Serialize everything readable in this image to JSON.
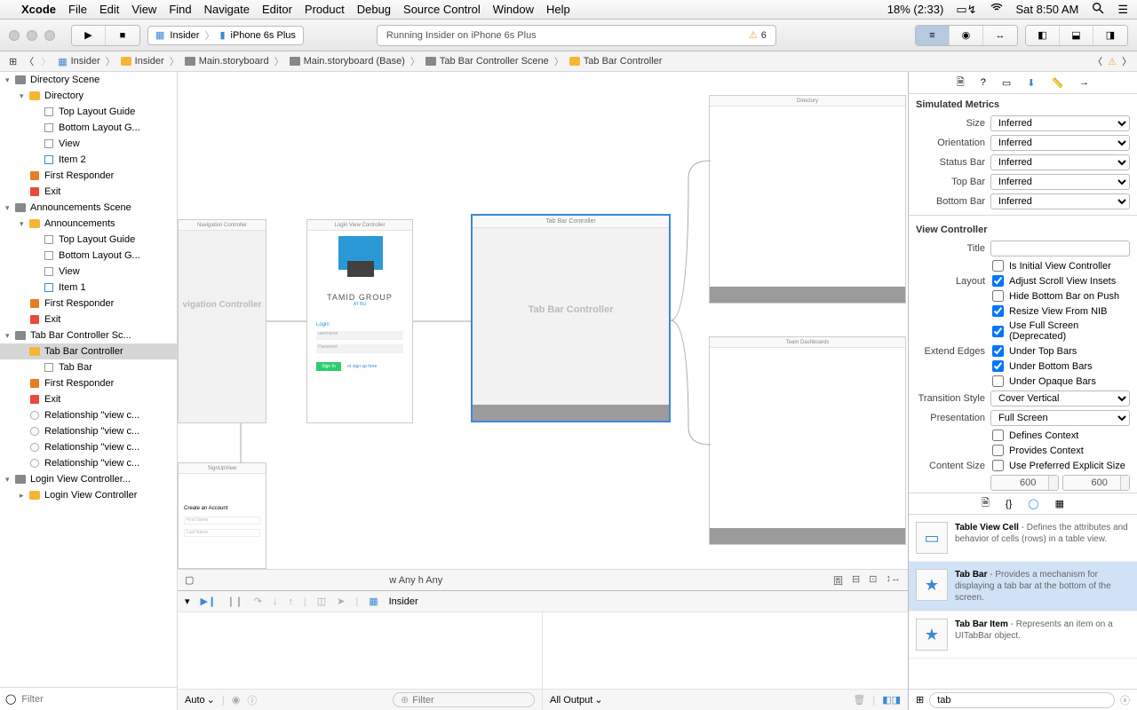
{
  "menubar": {
    "appname": "Xcode",
    "items": [
      "File",
      "Edit",
      "View",
      "Find",
      "Navigate",
      "Editor",
      "Product",
      "Debug",
      "Source Control",
      "Window",
      "Help"
    ],
    "battery": "18% (2:33)",
    "clock": "Sat 8:50 AM"
  },
  "toolbar": {
    "scheme_target": "Insider",
    "scheme_device": "iPhone 6s Plus",
    "activity_text": "Running Insider on iPhone 6s Plus",
    "warning_count": "6"
  },
  "jumpbar": {
    "segments": [
      "Insider",
      "Insider",
      "Main.storyboard",
      "Main.storyboard (Base)",
      "Tab Bar Controller Scene",
      "Tab Bar Controller"
    ]
  },
  "navigator": {
    "filter_placeholder": "Filter",
    "tree": [
      {
        "depth": 0,
        "disc": "▾",
        "ico": "scene",
        "label": "Directory Scene"
      },
      {
        "depth": 1,
        "disc": "▾",
        "ico": "folder",
        "label": "Directory"
      },
      {
        "depth": 2,
        "disc": "",
        "ico": "view",
        "label": "Top Layout Guide"
      },
      {
        "depth": 2,
        "disc": "",
        "ico": "view",
        "label": "Bottom Layout G..."
      },
      {
        "depth": 2,
        "disc": "",
        "ico": "view",
        "label": "View"
      },
      {
        "depth": 2,
        "disc": "",
        "ico": "item",
        "label": "Item 2"
      },
      {
        "depth": 1,
        "disc": "",
        "ico": "cube",
        "label": "First Responder"
      },
      {
        "depth": 1,
        "disc": "",
        "ico": "exit",
        "label": "Exit"
      },
      {
        "depth": 0,
        "disc": "▾",
        "ico": "scene",
        "label": "Announcements Scene"
      },
      {
        "depth": 1,
        "disc": "▾",
        "ico": "folder",
        "label": "Announcements"
      },
      {
        "depth": 2,
        "disc": "",
        "ico": "view",
        "label": "Top Layout Guide"
      },
      {
        "depth": 2,
        "disc": "",
        "ico": "view",
        "label": "Bottom Layout G..."
      },
      {
        "depth": 2,
        "disc": "",
        "ico": "view",
        "label": "View"
      },
      {
        "depth": 2,
        "disc": "",
        "ico": "item",
        "label": "Item 1"
      },
      {
        "depth": 1,
        "disc": "",
        "ico": "cube",
        "label": "First Responder"
      },
      {
        "depth": 1,
        "disc": "",
        "ico": "exit",
        "label": "Exit"
      },
      {
        "depth": 0,
        "disc": "▾",
        "ico": "scene",
        "label": "Tab Bar Controller Sc..."
      },
      {
        "depth": 1,
        "disc": "",
        "ico": "folder",
        "label": "Tab Bar Controller",
        "sel": true
      },
      {
        "depth": 2,
        "disc": "",
        "ico": "view",
        "label": "Tab Bar"
      },
      {
        "depth": 1,
        "disc": "",
        "ico": "cube",
        "label": "First Responder"
      },
      {
        "depth": 1,
        "disc": "",
        "ico": "exit",
        "label": "Exit"
      },
      {
        "depth": 1,
        "disc": "",
        "ico": "rel",
        "label": "Relationship \"view c..."
      },
      {
        "depth": 1,
        "disc": "",
        "ico": "rel",
        "label": "Relationship \"view c..."
      },
      {
        "depth": 1,
        "disc": "",
        "ico": "rel",
        "label": "Relationship \"view c..."
      },
      {
        "depth": 1,
        "disc": "",
        "ico": "rel",
        "label": "Relationship \"view c..."
      },
      {
        "depth": 0,
        "disc": "▾",
        "ico": "scene",
        "label": "Login View Controller..."
      },
      {
        "depth": 1,
        "disc": "▸",
        "ico": "folder",
        "label": "Login View Controller"
      }
    ]
  },
  "canvas": {
    "scenes": {
      "nav_controller": "Navigation Controller",
      "nav_body": "vigation Controller",
      "login_title": "Login View Controller",
      "login_brand": "TAMID GROUP",
      "login_sub": "AT BU",
      "login_label": "Login",
      "login_user_ph": "username",
      "login_pass_ph": "Password",
      "login_signin": "Sign In",
      "login_signup": "or sign up here",
      "signup_title": "SignUpView",
      "signup_header": "Create an Account",
      "signup_first": "First Name",
      "signup_last": "Last Name",
      "tabbar_title": "Tab Bar Controller",
      "tabbar_body": "Tab Bar Controller",
      "directory_title": "Directory",
      "team_title": "Team Dashboards"
    },
    "size_class_w": "w Any",
    "size_class_h": "h Any"
  },
  "debug": {
    "target": "Insider",
    "auto_label": "Auto",
    "filter_placeholder": "Filter",
    "output_label": "All Output"
  },
  "inspector": {
    "simulated_metrics_label": "Simulated Metrics",
    "size_label": "Size",
    "size_value": "Inferred",
    "orientation_label": "Orientation",
    "orientation_value": "Inferred",
    "statusbar_label": "Status Bar",
    "statusbar_value": "Inferred",
    "topbar_label": "Top Bar",
    "topbar_value": "Inferred",
    "bottombar_label": "Bottom Bar",
    "bottombar_value": "Inferred",
    "view_controller_label": "View Controller",
    "title_label": "Title",
    "title_value": "",
    "initial_label": "Is Initial View Controller",
    "layout_label": "Layout",
    "adjust_label": "Adjust Scroll View Insets",
    "hide_label": "Hide Bottom Bar on Push",
    "resize_label": "Resize View From NIB",
    "fullscreen_label": "Use Full Screen (Deprecated)",
    "extend_label": "Extend Edges",
    "under_top_label": "Under Top Bars",
    "under_bottom_label": "Under Bottom Bars",
    "under_opaque_label": "Under Opaque Bars",
    "transition_label": "Transition Style",
    "transition_value": "Cover Vertical",
    "presentation_label": "Presentation",
    "presentation_value": "Full Screen",
    "defines_label": "Defines Context",
    "provides_label": "Provides Context",
    "csize_label": "Content Size",
    "csize_pref": "Use Preferred Explicit Size",
    "csize_w": "600",
    "csize_h": "600"
  },
  "library": {
    "filter_value": "tab",
    "items": [
      {
        "title": "Table View Cell",
        "desc": " - Defines the attributes and behavior of cells (rows) in a table view.",
        "sel": false,
        "star": false
      },
      {
        "title": "Tab Bar",
        "desc": " - Provides a mechanism for displaying a tab bar at the bottom of the screen.",
        "sel": true,
        "star": true
      },
      {
        "title": "Tab Bar Item",
        "desc": " - Represents an item on a UITabBar object.",
        "sel": false,
        "star": true
      }
    ]
  }
}
